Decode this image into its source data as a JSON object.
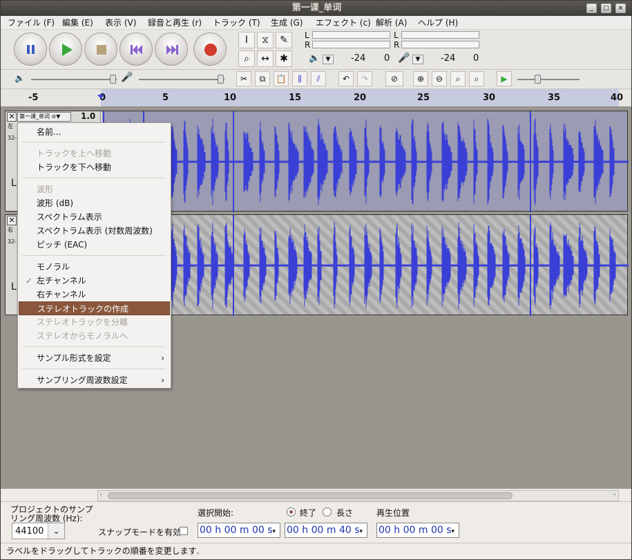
{
  "window": {
    "title": "第一课_单词"
  },
  "menubar": [
    "ファイル (F)",
    "編集 (E)",
    "表示 (V)",
    "録音と再生 (r)",
    "トラック (T)",
    "生成 (G)",
    "エフェクト (c)",
    "解析 (A)",
    "ヘルプ (H)"
  ],
  "meters": {
    "playback_L": "L",
    "playback_R": "R",
    "record_L": "L",
    "record_R": "R",
    "db1": "-24",
    "zero1": "0",
    "db2": "-24",
    "zero2": "0"
  },
  "ruler": {
    "ticks": [
      "-5",
      "0",
      "5",
      "10",
      "15",
      "20",
      "25",
      "30",
      "35",
      "40"
    ]
  },
  "track1": {
    "name": "第一课_单词",
    "gain": "1.0",
    "info1": "左",
    "info2": "32-",
    "letter": "L"
  },
  "track2": {
    "info1": "右",
    "info2": "32-",
    "letter": "L"
  },
  "context_menu": {
    "rename": "名前...",
    "move_up": "トラックを上へ移動",
    "move_down": "トラックを下へ移動",
    "waveform": "波形",
    "waveform_db": "波形 (dB)",
    "spectrum": "スペクトラム表示",
    "spectrum_log": "スペクトラム表示 (対数周波数)",
    "pitch": "ピッチ (EAC)",
    "mono": "モノラル",
    "left": "左チャンネル",
    "right": "右チャンネル",
    "make_stereo": "ステレオトラックの作成",
    "split_stereo": "ステレオトラックを分離",
    "stereo_to_mono": "ステレオからモノラルへ",
    "sample_format": "サンプル形式を設定",
    "sample_rate": "サンプリング周波数設定"
  },
  "bottom": {
    "project_rate_label1": "プロジェクトのサンプ",
    "project_rate_label2": "リング周波数 (Hz):",
    "project_rate_value": "44100",
    "snap_label": "スナップモードを有効",
    "selection_start_label": "選択開始:",
    "end_label": "終了",
    "length_label": "長さ",
    "play_pos_label": "再生位置",
    "sel_start": "00 h 00 m 00 s",
    "sel_end": "00 h 00 m 40 s",
    "play_pos": "00 h 00 m 00 s"
  },
  "status": {
    "text": "ラベルをドラッグしてトラックの順番を変更します."
  },
  "colors": {
    "wave": "#3a3fd6",
    "highlight": "#8a573d",
    "selection_bg": "#9b9bb3"
  }
}
